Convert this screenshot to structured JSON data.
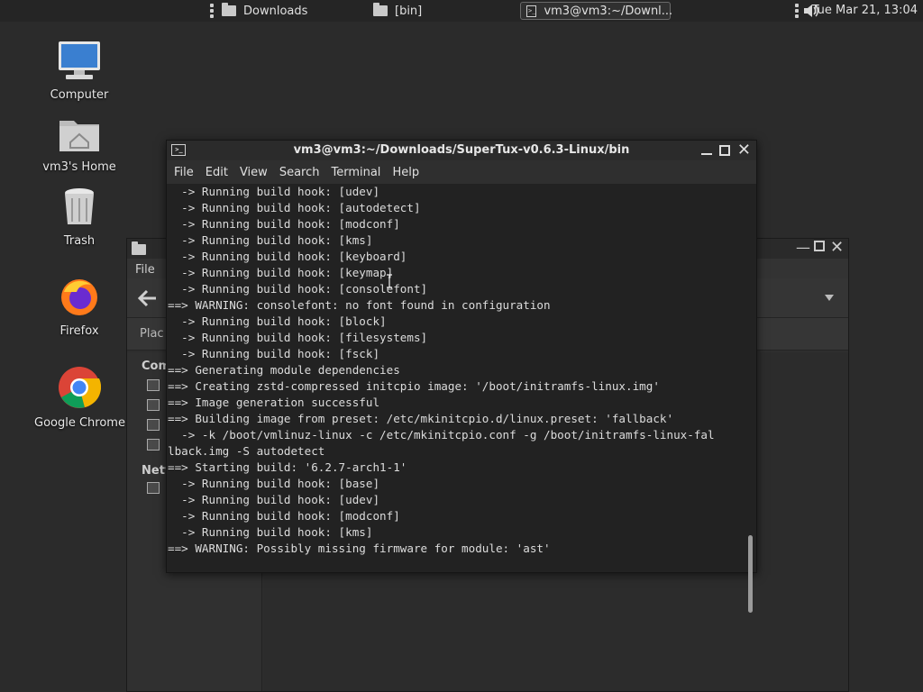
{
  "taskbar": {
    "tasks": [
      {
        "label": "Downloads"
      },
      {
        "label": "[bin]"
      },
      {
        "label": "vm3@vm3:~/Downl..."
      }
    ],
    "clock": "Tue Mar 21, 13:04"
  },
  "desktop": {
    "icons": [
      {
        "label": "Computer",
        "icon": "computer-icon"
      },
      {
        "label": "vm3's Home",
        "icon": "home-folder-icon"
      },
      {
        "label": "Trash",
        "icon": "trash-icon"
      },
      {
        "label": "Firefox",
        "icon": "firefox-icon"
      },
      {
        "label": "Google Chrome",
        "icon": "chrome-icon"
      }
    ]
  },
  "file_manager": {
    "menu_file": "File",
    "location_label": "Plac",
    "sidebar": {
      "section_computer": "Com",
      "section_network": "Netw"
    }
  },
  "terminal": {
    "title": "vm3@vm3:~/Downloads/SuperTux-v0.6.3-Linux/bin",
    "menu": [
      "File",
      "Edit",
      "View",
      "Search",
      "Terminal",
      "Help"
    ],
    "lines": [
      "  -> Running build hook: [udev]",
      "  -> Running build hook: [autodetect]",
      "  -> Running build hook: [modconf]",
      "  -> Running build hook: [kms]",
      "  -> Running build hook: [keyboard]",
      "  -> Running build hook: [keymap]",
      "  -> Running build hook: [consolefont]",
      "==> WARNING: consolefont: no font found in configuration",
      "  -> Running build hook: [block]",
      "  -> Running build hook: [filesystems]",
      "  -> Running build hook: [fsck]",
      "==> Generating module dependencies",
      "==> Creating zstd-compressed initcpio image: '/boot/initramfs-linux.img'",
      "==> Image generation successful",
      "==> Building image from preset: /etc/mkinitcpio.d/linux.preset: 'fallback'",
      "  -> -k /boot/vmlinuz-linux -c /etc/mkinitcpio.conf -g /boot/initramfs-linux-fal",
      "lback.img -S autodetect",
      "==> Starting build: '6.2.7-arch1-1'",
      "  -> Running build hook: [base]",
      "  -> Running build hook: [udev]",
      "  -> Running build hook: [modconf]",
      "  -> Running build hook: [kms]",
      "==> WARNING: Possibly missing firmware for module: 'ast'"
    ]
  },
  "colors": {
    "desktop_bg": "#2b2b2b",
    "terminal_bg": "#222222",
    "terminal_text": "#dcdcdc"
  }
}
